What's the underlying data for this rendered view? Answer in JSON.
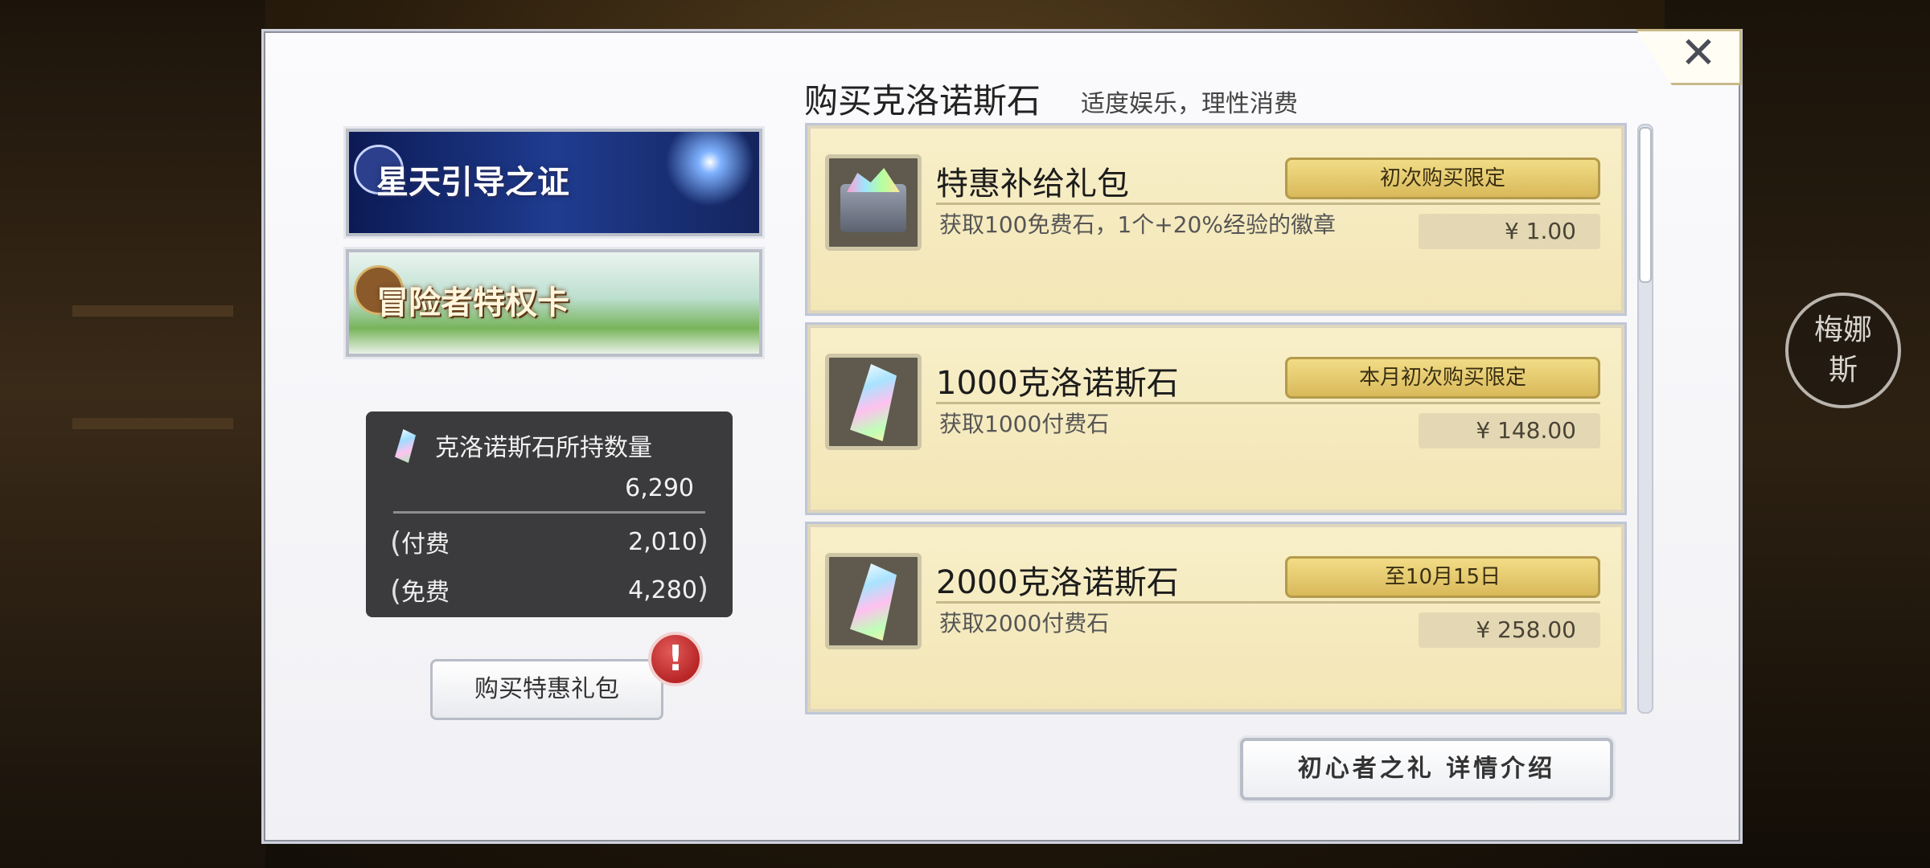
{
  "window": {
    "close_label": "✕"
  },
  "left": {
    "banners": [
      {
        "label": "星天引导之证"
      },
      {
        "label": "冒险者特权卡"
      }
    ],
    "stone_panel": {
      "title": "克洛诺斯石所持数量",
      "total": "6,290",
      "paid_label": "付费",
      "paid_value": "2,010",
      "free_label": "免费",
      "free_value": "4,280"
    },
    "special_pack_button": "购买特惠礼包",
    "alert_badge": "!"
  },
  "shop": {
    "title": "购买克洛诺斯石",
    "subtitle": "适度娱乐，理性消费",
    "items": [
      {
        "name": "特惠补给礼包",
        "tag": "初次购买限定",
        "desc": "获取100免费石，1个+20%经验的徽章",
        "price": "¥  1.00",
        "icon": "treasure-chest-icon"
      },
      {
        "name": "1000克洛诺斯石",
        "tag": "本月初次购买限定",
        "desc": "获取1000付费石",
        "price": "¥  148.00",
        "icon": "chronos-stone-icon"
      },
      {
        "name": "2000克洛诺斯石",
        "tag": "至10月15日",
        "desc": "获取2000付费石",
        "price": "¥  258.00",
        "icon": "chronos-stone-icon"
      }
    ],
    "guide_button": "初心者之礼 详情介绍"
  },
  "side_character": {
    "name": "梅娜斯"
  },
  "colors": {
    "item_bg": "#f6ecc3",
    "tag_gold": "#e6c86e",
    "panel_dark": "#3b3b3d",
    "alert_red": "#c43030"
  }
}
